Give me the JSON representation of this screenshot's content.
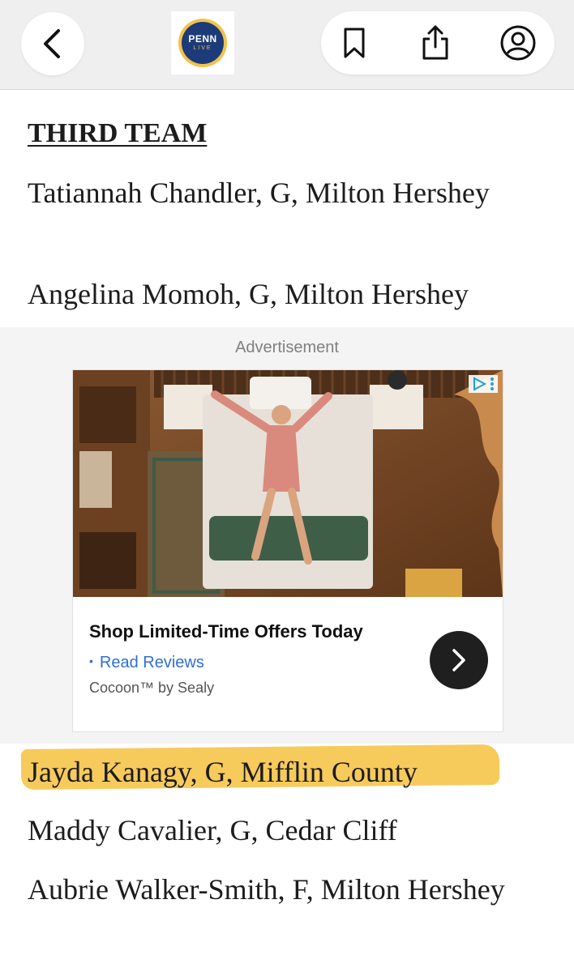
{
  "topbar": {
    "logo": {
      "line1": "PENN",
      "line2": "LIVE"
    },
    "icons": [
      "chevron-left-icon",
      "bookmark-icon",
      "share-icon",
      "account-icon"
    ]
  },
  "article": {
    "heading": "THIRD TEAM",
    "players": [
      "Tatiannah Chandler, G, Milton Hershey",
      "Angelina Momoh, G, Milton Hershey",
      "Jayda Kanagy, G, Mifflin County",
      "Maddy Cavalier, G, Cedar Cliff",
      "Aubrie Walker-Smith, F, Milton Hershey"
    ],
    "highlight_color": "#f6c13f"
  },
  "ad": {
    "label": "Advertisement",
    "title": "Shop Limited-Time Offers Today",
    "link_bullet": "•",
    "link_text": "Read Reviews",
    "advertiser": "Cocoon™ by Sealy",
    "accent_color": "#2f6fd6"
  }
}
